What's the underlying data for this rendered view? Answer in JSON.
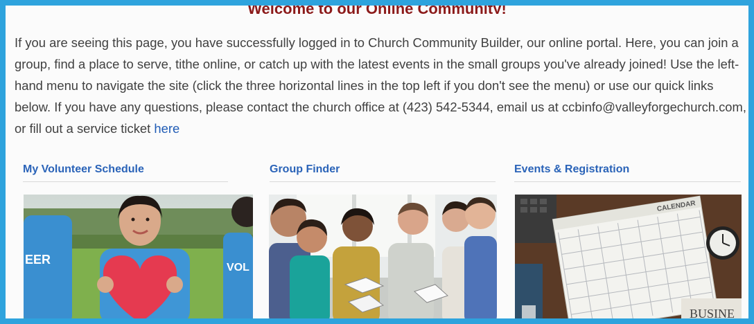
{
  "welcome_heading": "Welcome to our Online Community!",
  "intro": {
    "text": "If you are seeing this page, you have successfully logged in to Church Community Builder, our online portal. Here, you can join a group, find a place to serve, tithe online, or catch up with the latest events in the small groups you've already joined! Use the left-hand menu to navigate the site (click the three horizontal lines in the top left if you don't see the menu) or use our quick links below. If you have any questions, please contact the church office at (423) 542-5344, email us at ccbinfo@valleyforgechurch.com, or fill out a service ticket",
    "link_label": "here"
  },
  "quick_links": [
    {
      "title": "My Volunteer Schedule",
      "image": "volunteers-holding-heart-photo"
    },
    {
      "title": "Group Finder",
      "image": "small-group-bible-study-photo"
    },
    {
      "title": "Events & Registration",
      "image": "desk-calendar-photo"
    }
  ],
  "photo_text": {
    "shirt_left": "EER",
    "shirt_right": "VOL",
    "calendar_header": "CALENDAR",
    "newspaper": "BUSINE"
  },
  "colors": {
    "frame_border": "#2ea3dd",
    "heading": "#8b1a1a",
    "link": "#2a63b8"
  }
}
